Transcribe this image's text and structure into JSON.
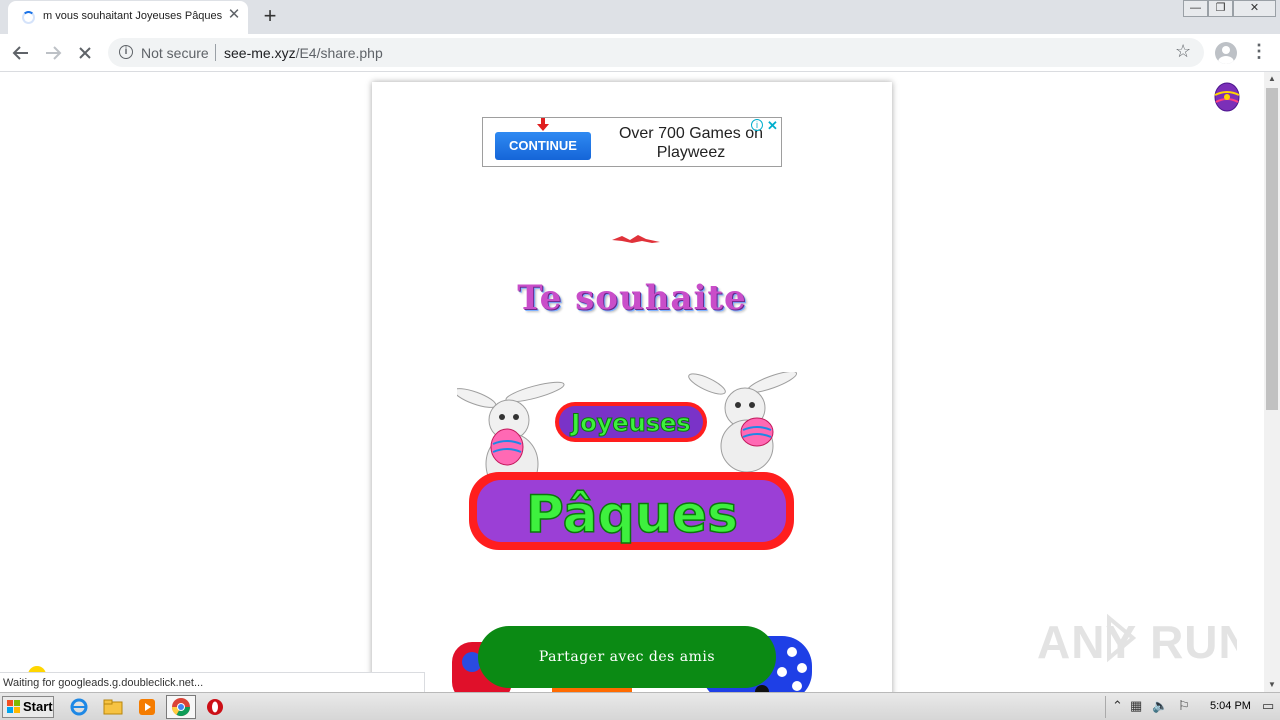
{
  "browser": {
    "tab_title": "m vous souhaitant Joyeuses Pâques",
    "tab_close": "✕",
    "new_tab": "+",
    "security_label": "Not secure",
    "url_host": "see-me.xyz",
    "url_path": "/E4/share.php",
    "window_controls": {
      "minimize": "—",
      "restore": "❐",
      "close": "✕"
    }
  },
  "ad": {
    "button_label": "CONTINUE",
    "text": "Over 700 Games on Playweez",
    "info": "i",
    "close": "✕"
  },
  "page": {
    "heading": "Te souhaite",
    "greeting_word1": "Joyeuses",
    "greeting_word2": "Pâques",
    "share_button": "Partager avec des amis"
  },
  "watermark": "ANY RUN",
  "status_text": "Waiting for googleads.g.doubleclick.net...",
  "taskbar": {
    "start_label": "Start",
    "clock": "5:04 PM"
  },
  "colors": {
    "share_button": "#0b8a14",
    "ad_button": "#1a73e8",
    "heading": "#c94ec9",
    "greeting_green": "#3ef03e",
    "greeting_red": "#ff1e1e"
  }
}
